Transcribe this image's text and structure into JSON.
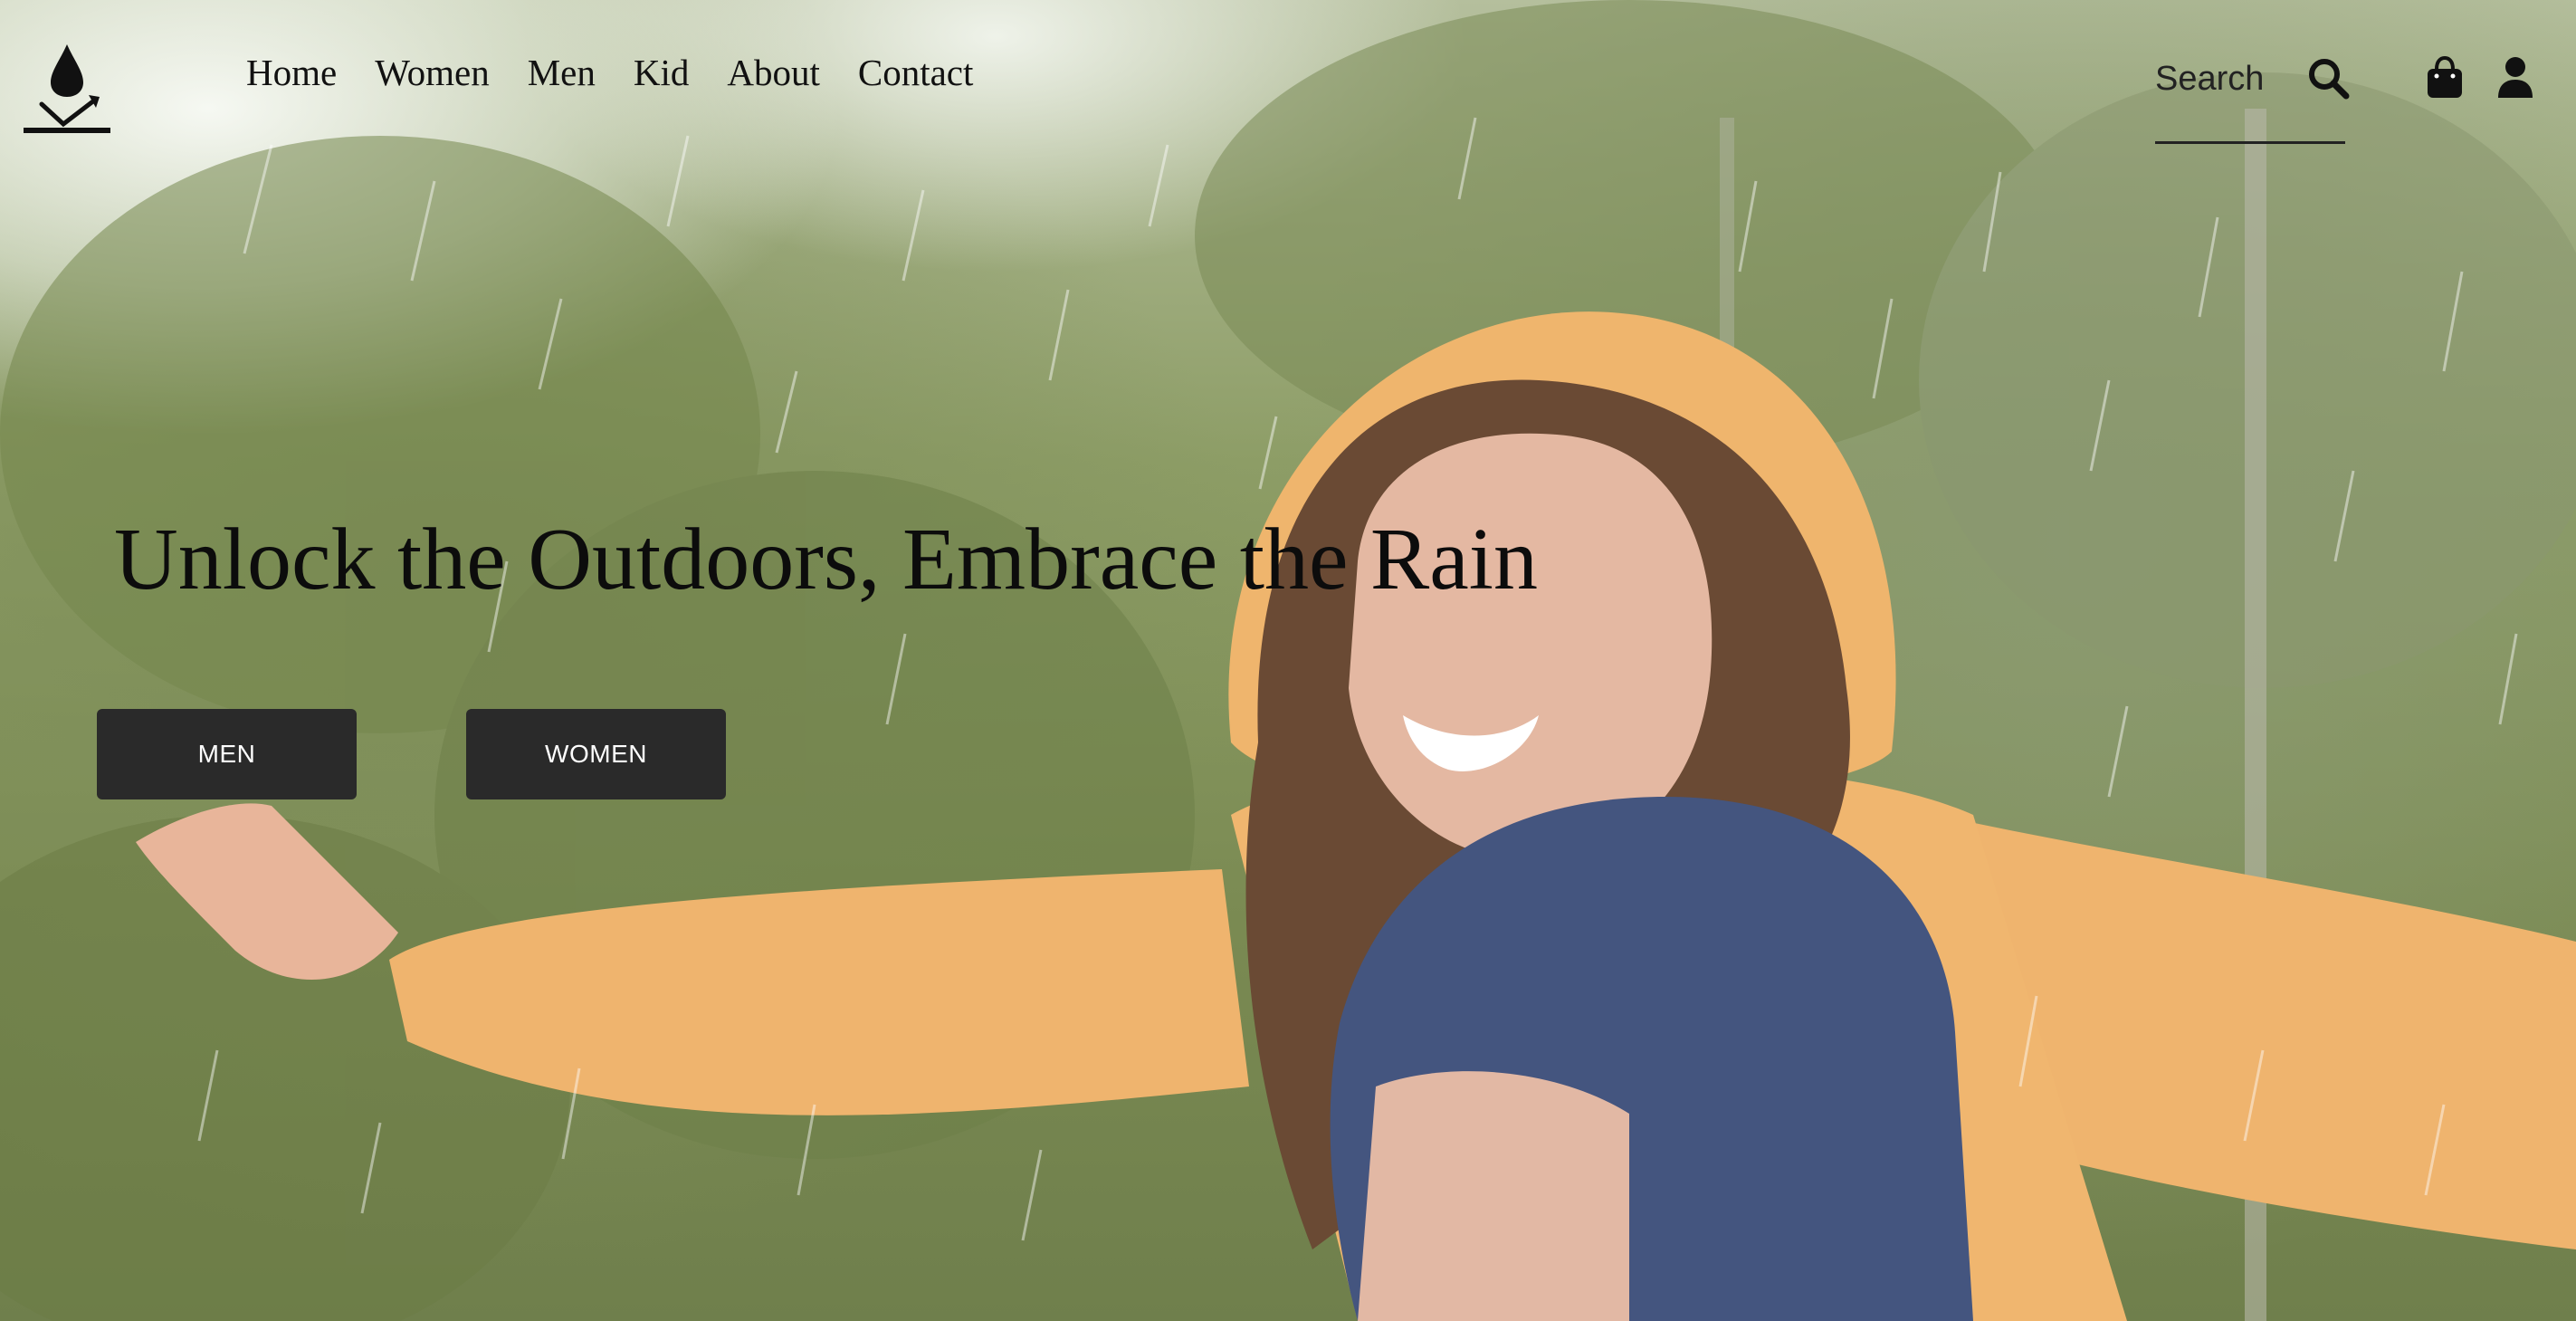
{
  "brand": {
    "logo_icon": "raindrop-arrow-logo-icon"
  },
  "nav": {
    "items": [
      {
        "label": "Home"
      },
      {
        "label": "Women"
      },
      {
        "label": "Men"
      },
      {
        "label": "Kid"
      },
      {
        "label": "About"
      },
      {
        "label": "Contact"
      }
    ]
  },
  "search": {
    "placeholder": "Search",
    "icon": "search-icon"
  },
  "header_icons": {
    "bag": "shopping-bag-icon",
    "user": "user-icon"
  },
  "hero": {
    "title": "Unlock the Outdoors, Embrace the Rain",
    "buttons": {
      "men_label": "MEN",
      "women_label": "WOMEN"
    },
    "image_description_colors": {
      "jacket": "#f0b570",
      "hood_blue": "#44557f",
      "foliage": "#7f8f5a"
    }
  },
  "colors": {
    "button_bg": "#2a2a2a",
    "button_text": "#ffffff",
    "text": "#111111"
  }
}
